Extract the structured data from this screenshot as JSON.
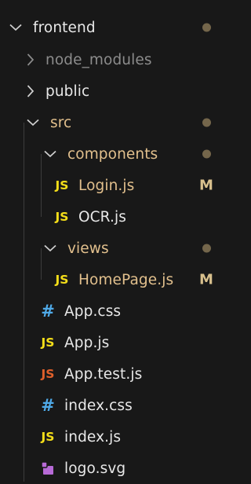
{
  "explorer": {
    "items": [
      {
        "label": "frontend",
        "kind": "folder",
        "expanded": true,
        "status": "dot"
      },
      {
        "label": "node_modules",
        "kind": "folder",
        "expanded": false,
        "dimmed": true
      },
      {
        "label": "public",
        "kind": "folder",
        "expanded": false
      },
      {
        "label": "src",
        "kind": "folder",
        "expanded": true,
        "status": "dot"
      },
      {
        "label": "components",
        "kind": "folder",
        "expanded": true,
        "status": "dot"
      },
      {
        "label": "Login.js",
        "kind": "file",
        "icon": "JS",
        "badge": "M"
      },
      {
        "label": "OCR.js",
        "kind": "file",
        "icon": "JS"
      },
      {
        "label": "views",
        "kind": "folder",
        "expanded": true,
        "status": "dot"
      },
      {
        "label": "HomePage.js",
        "kind": "file",
        "icon": "JS",
        "badge": "M"
      },
      {
        "label": "App.css",
        "kind": "file",
        "icon": "#"
      },
      {
        "label": "App.js",
        "kind": "file",
        "icon": "JS"
      },
      {
        "label": "App.test.js",
        "kind": "file",
        "icon": "JS"
      },
      {
        "label": "index.css",
        "kind": "file",
        "icon": "#"
      },
      {
        "label": "index.js",
        "kind": "file",
        "icon": "JS"
      },
      {
        "label": "logo.svg",
        "kind": "file",
        "icon": "svg-logo-icon"
      }
    ]
  },
  "colors": {
    "background": "#181818",
    "modified": "#e2c08d",
    "js_icon": "#f5de19",
    "test_icon": "#e0602b",
    "css_icon": "#4faae8",
    "svg_icon": "#b76ad6"
  }
}
